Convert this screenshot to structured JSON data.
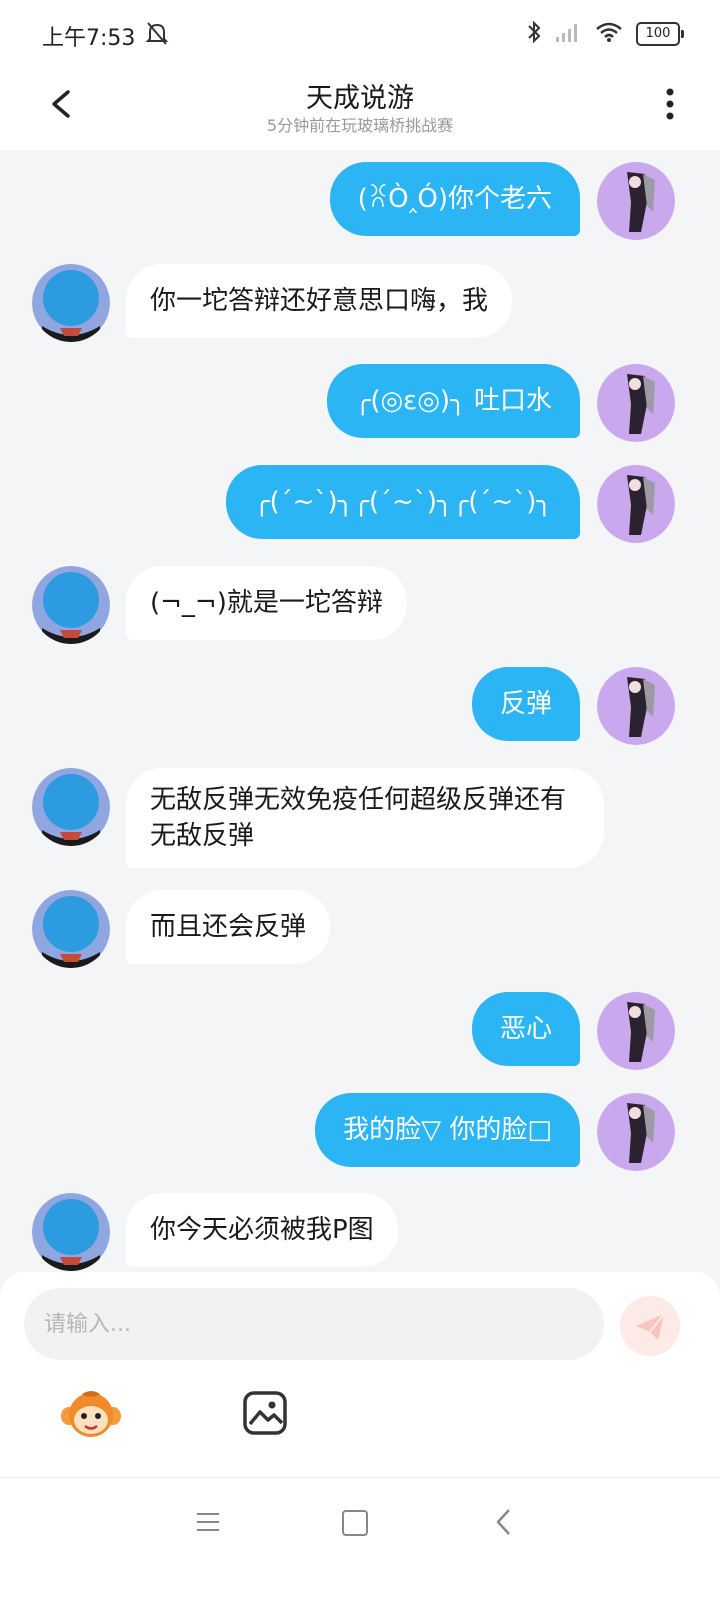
{
  "status_bar": {
    "time": "上午7:53",
    "battery": "100"
  },
  "header": {
    "title": "天成说游",
    "subtitle": "5分钟前在玩玻璃桥挑战赛"
  },
  "messages": [
    {
      "side": "right",
      "text": "(ꐦÒ‸Ó)你个老六"
    },
    {
      "side": "left",
      "text": "你一坨答辩还好意思口嗨，我"
    },
    {
      "side": "right",
      "text": "╭(◎ε◎)╮ 吐口水"
    },
    {
      "side": "right",
      "text": "╭(ˊ~ˋ)╮╭(ˊ~ˋ)╮╭(ˊ~ˋ)╮"
    },
    {
      "side": "left",
      "text": "(¬_¬)就是一坨答辩"
    },
    {
      "side": "right",
      "text": "反弹"
    },
    {
      "side": "left",
      "text": " 无敌反弹无效免疫任何超级反弹还有无敌反弹"
    },
    {
      "side": "left",
      "text": "而且还会反弹"
    },
    {
      "side": "right",
      "text": "恶心"
    },
    {
      "side": "right",
      "text": "我的脸▽ 你的脸□"
    },
    {
      "side": "left",
      "text": "你今天必须被我P图"
    }
  ],
  "input": {
    "placeholder": "请输入..."
  },
  "colors": {
    "bubble_self": "#2cb5f5",
    "bubble_other": "#ffffff",
    "background": "#f4f5f7"
  }
}
